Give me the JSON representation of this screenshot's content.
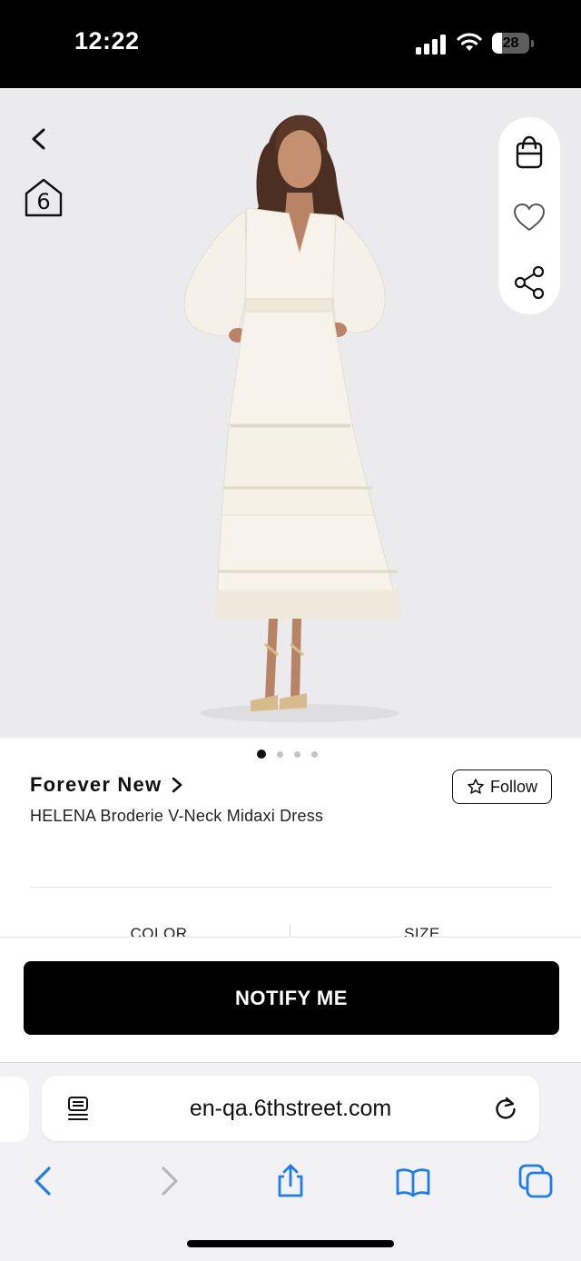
{
  "status_bar": {
    "time": "12:22",
    "battery_level": "28",
    "battery_fraction": 0.28,
    "icons": [
      "signal-icon",
      "wifi-icon",
      "battery-icon"
    ]
  },
  "product_gallery": {
    "image_alt": "HELENA Broderie V-Neck Midaxi Dress",
    "image_count": 4,
    "active_index": 0,
    "overlay_icons": [
      "back-chevron-icon",
      "sixth-street-logo-icon",
      "shopping-bag-icon",
      "heart-icon",
      "share-icon"
    ]
  },
  "product": {
    "brand": "Forever New",
    "title": "HELENA Broderie V-Neck Midaxi Dress",
    "follow_label": "Follow"
  },
  "tabs": {
    "color_label": "COLOR",
    "size_label": "SIZE"
  },
  "cta": {
    "notify_label": "NOTIFY ME"
  },
  "browser": {
    "url": "en-qa.6thstreet.com",
    "toolbar_icons": [
      "back-icon",
      "forward-icon",
      "share-icon",
      "bookmarks-icon",
      "tabs-icon"
    ],
    "forward_enabled": false
  },
  "colors": {
    "accent_blue": "#1c7cf4",
    "button_black": "#000000",
    "hero_bg": "#ebebed",
    "dress_white": "#f7f3ea"
  }
}
